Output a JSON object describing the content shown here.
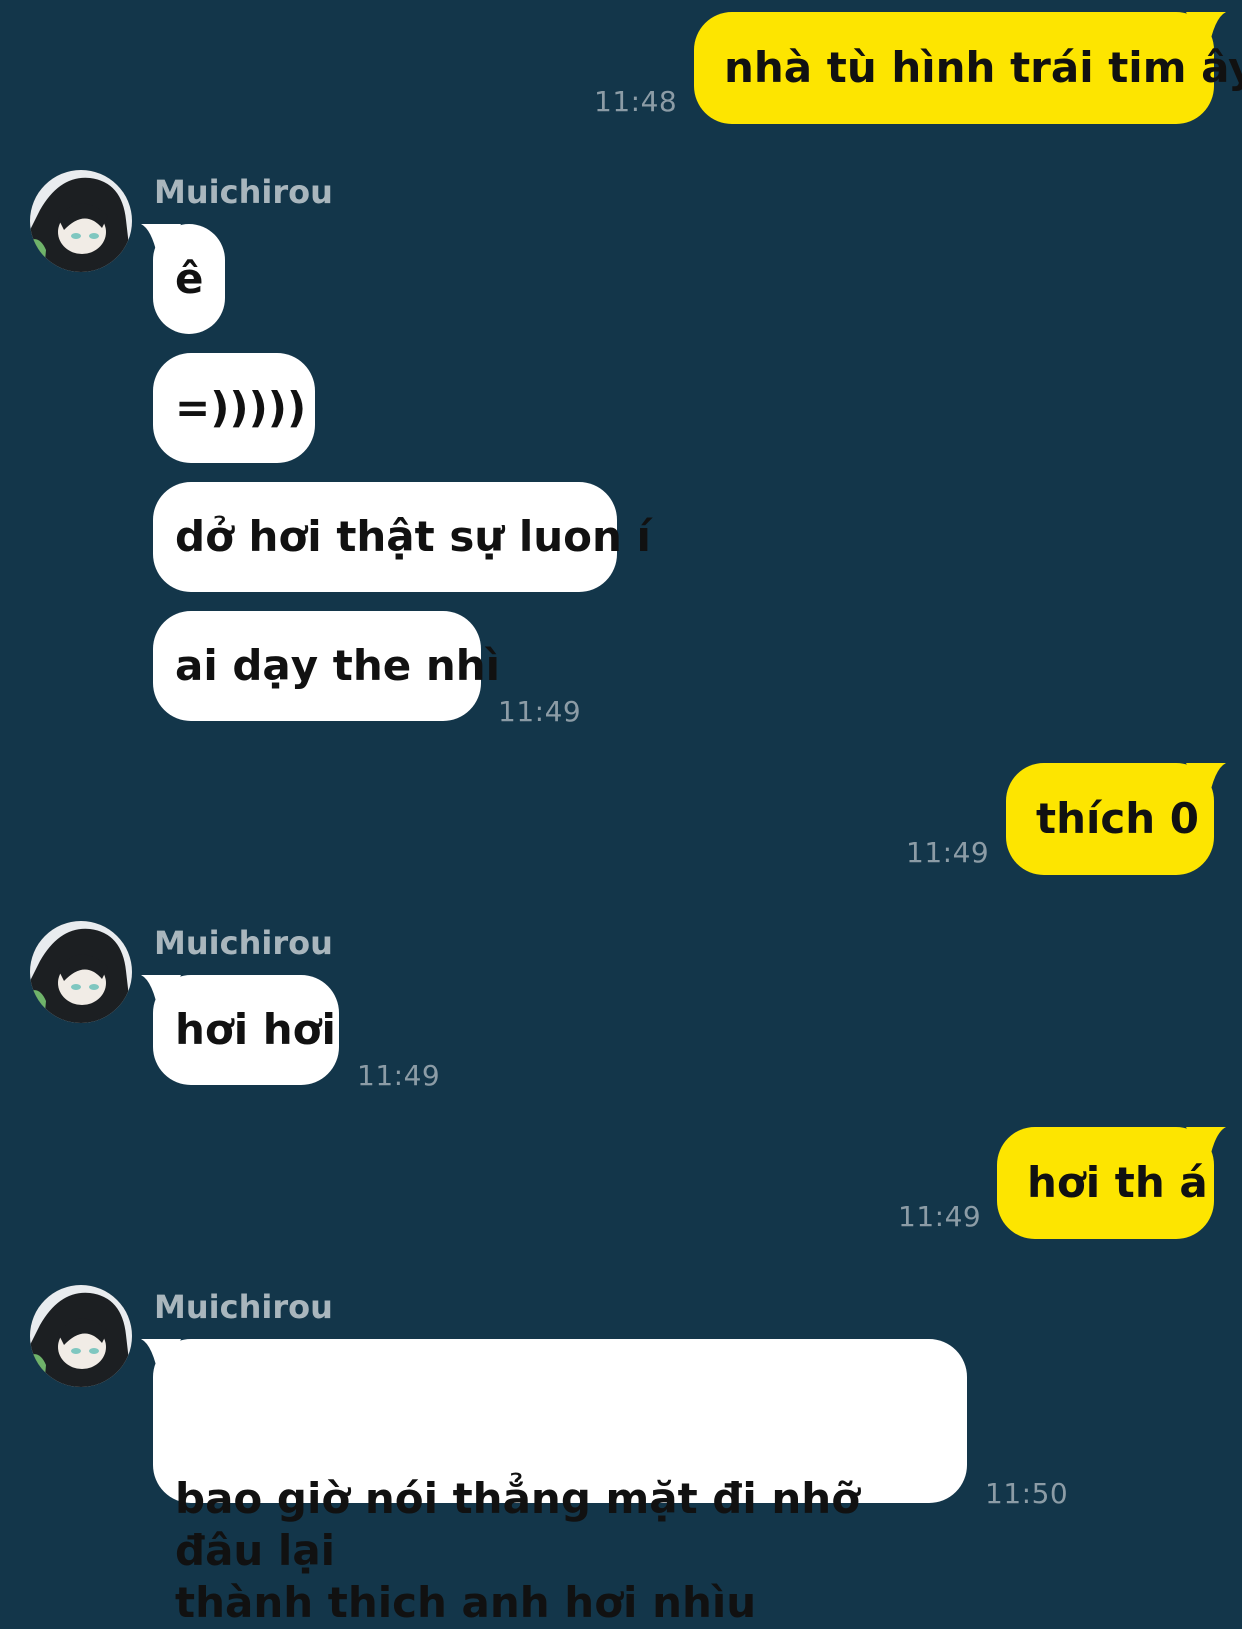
{
  "colors": {
    "background": "#13364a",
    "outgoing_bubble": "#fde500",
    "incoming_bubble": "#ffffff",
    "timestamp": "#8c9ca6",
    "sender_name": "#a9b6bd"
  },
  "messages": {
    "m1": {
      "text": "nhà tù hình trái tim ây",
      "time": "11:48"
    },
    "g1": {
      "sender": "Muichirou",
      "avatar_icon": "anime-character-avatar",
      "b1": "ê",
      "b2": "=)))))",
      "b3": "dở hơi thật sự luon í",
      "b4": "ai dạy the nhì",
      "time": "11:49"
    },
    "m2": {
      "text": "thích 0",
      "time": "11:49"
    },
    "g2": {
      "sender": "Muichirou",
      "avatar_icon": "anime-character-avatar",
      "b1": "hơi hơi",
      "time": "11:49"
    },
    "m3": {
      "text": "hơi th á",
      "time": "11:49"
    },
    "g3": {
      "sender": "Muichirou",
      "avatar_icon": "anime-character-avatar",
      "b1": "bao giờ nói thẳng mặt đi nhỡ đâu lại\nthành thich anh hơi nhìu",
      "time": "11:50"
    }
  }
}
